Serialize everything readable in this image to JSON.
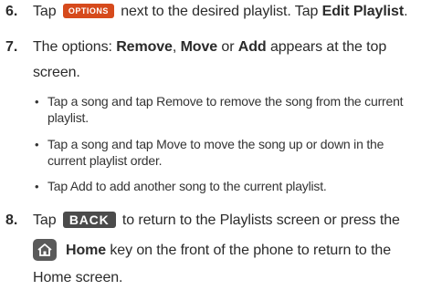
{
  "steps": [
    {
      "number": "6.",
      "line1_a": "Tap ",
      "button": "OPTIONS",
      "line1_b": " next to the desired playlist. Tap ",
      "line1_bold": "Edit Playlist",
      "line1_end": "."
    },
    {
      "number": "7.",
      "line1_a": "The options: ",
      "opt1": "Remove",
      "sep1": ", ",
      "opt2": "Move",
      "sep2": " or ",
      "opt3": "Add",
      "line1_b": " appears at the top",
      "line2": "screen.",
      "bullets": [
        {
          "line1": "Tap a song and tap Remove to remove the song from the current",
          "line2": "playlist."
        },
        {
          "line1": "Tap a song and tap Move to move the song up or down in the",
          "line2": "current playlist order."
        },
        {
          "line1": "Tap Add to add another song to the current playlist.",
          "line2": ""
        }
      ]
    },
    {
      "number": "8.",
      "line1_a": "Tap ",
      "button": "BACK",
      "line1_b": " to return to the Playlists screen or press the",
      "home_icon": "home-icon",
      "line2_bold": "Home",
      "line2_rest": " key on the front of the phone to return to the",
      "line3": "Home screen."
    }
  ],
  "colors": {
    "options_button": "#d64a1c",
    "back_button": "#4b4b4b",
    "home_key": "#5a5a5a"
  }
}
